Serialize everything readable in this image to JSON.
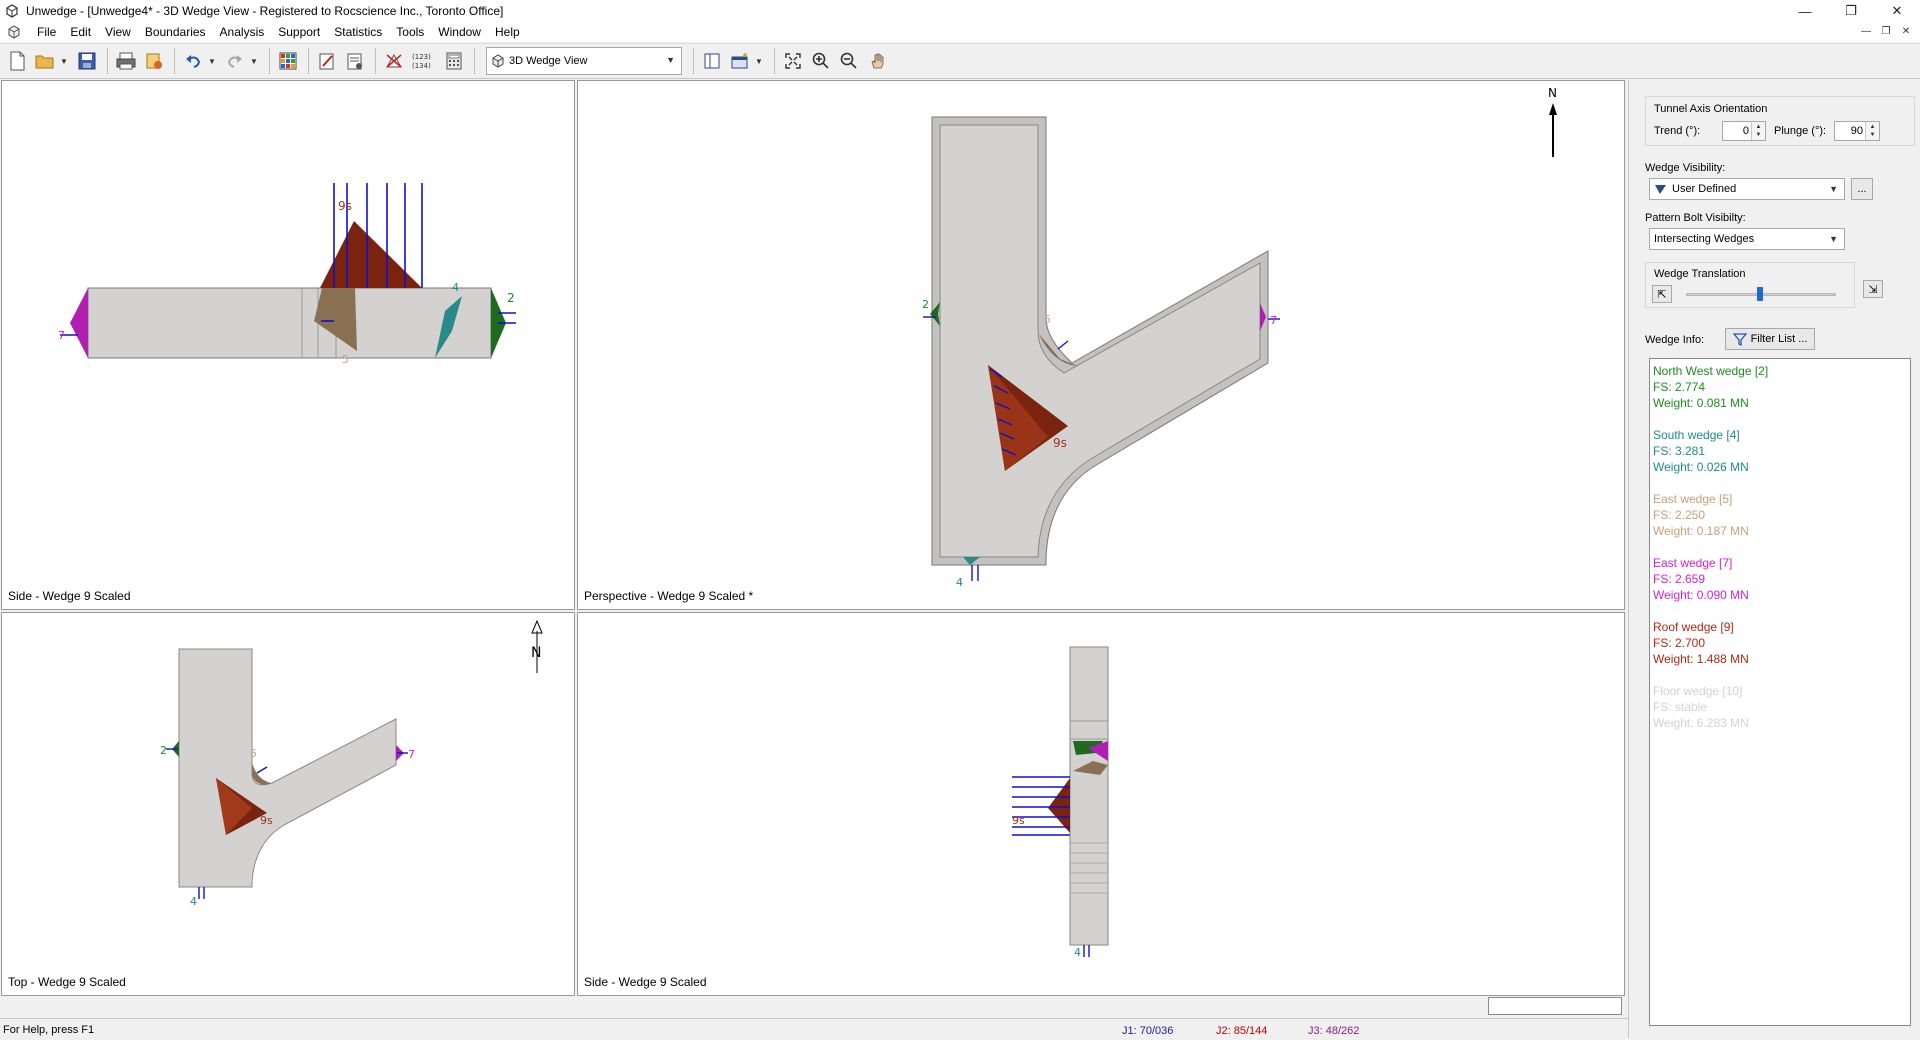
{
  "window": {
    "title": "Unwedge - [Unwedge4* - 3D Wedge View - Registered to Rocscience Inc., Toronto Office]",
    "controls": [
      "—",
      "❐",
      "✕"
    ]
  },
  "menu": [
    "File",
    "Edit",
    "View",
    "Boundaries",
    "Analysis",
    "Support",
    "Statistics",
    "Tools",
    "Window",
    "Help"
  ],
  "toolbar": {
    "view_select": "3D Wedge View",
    "icons": [
      "new-file-icon",
      "open-folder-icon",
      "save-icon",
      "print-icon",
      "export-icon",
      "undo-icon",
      "redo-icon",
      "grid-view-icon",
      "edit-icon",
      "properties-icon",
      "joint-combo-icon",
      "joint-numbers-icon",
      "calculator-icon",
      "layout-icon",
      "add-view-icon",
      "zoom-extents-icon",
      "zoom-in-icon",
      "zoom-out-icon",
      "pan-icon"
    ],
    "joint_numbers_label": "(123)\n(134)"
  },
  "viewports": {
    "top_left": {
      "caption": "Side - Wedge 9 Scaled"
    },
    "top_right": {
      "caption": "Perspective - Wedge 9 Scaled *"
    },
    "bottom_left": {
      "caption": "Top - Wedge 9 Scaled"
    },
    "bottom_right": {
      "caption": "Side - Wedge 9 Scaled"
    },
    "north_label": "N",
    "labels": {
      "w2": "2",
      "w4": "4",
      "w5": "5",
      "w7": "7",
      "w9": "9s",
      "w3": "3"
    }
  },
  "panel": {
    "tunnel_axis": {
      "title": "Tunnel Axis Orientation",
      "trend_label": "Trend (°):",
      "trend_value": "0",
      "plunge_label": "Plunge (°):",
      "plunge_value": "90"
    },
    "wedge_visibility": {
      "label": "Wedge Visibility:",
      "value": "User Defined",
      "more": "..."
    },
    "bolt_visibility": {
      "label": "Pattern Bolt Visibilty:",
      "value": "Intersecting Wedges"
    },
    "translation": {
      "title": "Wedge Translation",
      "position": 0.49
    },
    "wedge_info": {
      "label": "Wedge Info:",
      "filter_button": "Filter List ..."
    },
    "wedges": [
      {
        "name": "North West wedge [2]",
        "fs": "FS: 2.774",
        "weight": "Weight: 0.081 MN",
        "color": "#1f8a1f"
      },
      {
        "name": "South wedge [4]",
        "fs": "FS: 3.281",
        "weight": "Weight: 0.026 MN",
        "color": "#1f8a8a"
      },
      {
        "name": "East wedge [5]",
        "fs": "FS: 2.250",
        "weight": "Weight: 0.187 MN",
        "color": "#c8a078"
      },
      {
        "name": "East wedge [7]",
        "fs": "FS: 2.659",
        "weight": "Weight: 0.090 MN",
        "color": "#d21ed2"
      },
      {
        "name": "Roof wedge [9]",
        "fs": "FS: 2.700",
        "weight": "Weight: 1.488 MN",
        "color": "#b02810"
      },
      {
        "name": "Floor wedge [10]",
        "fs": "FS: stable",
        "weight": "Weight: 6.283 MN",
        "color": "#d2d2d2"
      }
    ]
  },
  "status": {
    "help": "For Help, press F1",
    "j1": "J1: 70/036",
    "j2": "J2: 85/144",
    "j3": "J3: 48/262"
  },
  "colors": {
    "tunnel": "#d4d2d0",
    "roof_wedge": "#7a2410",
    "bolt": "#1010c8",
    "nw_wedge": "#1e6a1e",
    "east5": "#8a7052",
    "east7": "#b020b0",
    "south4": "#2a8a8a"
  }
}
